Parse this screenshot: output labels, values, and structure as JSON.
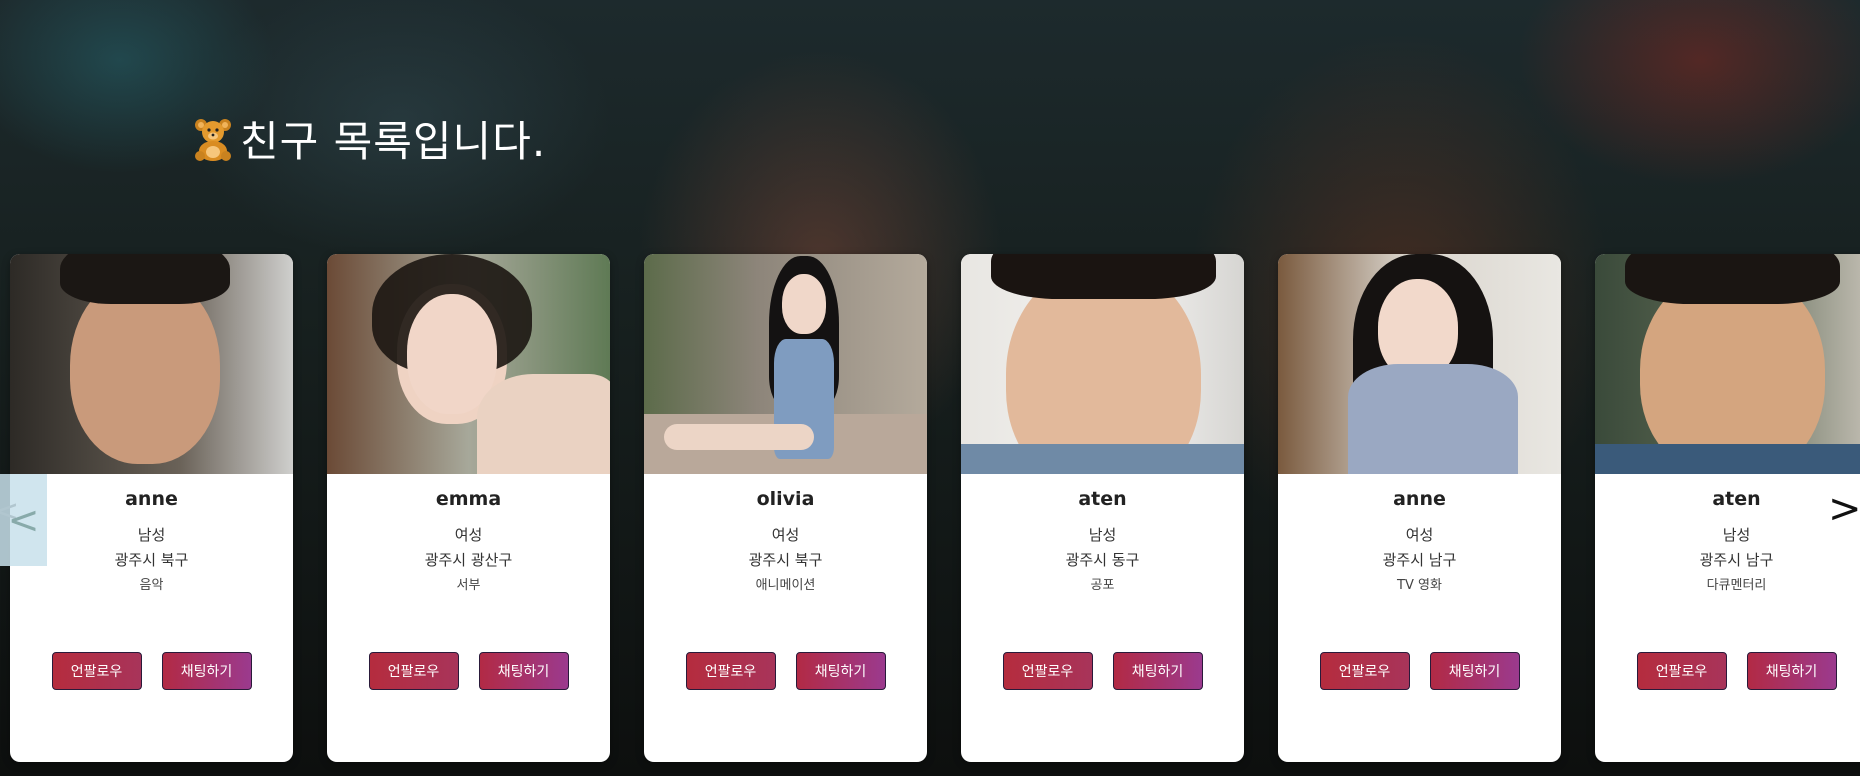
{
  "page": {
    "title": "친구 목록입니다.",
    "title_icon": "teddy-bear-icon"
  },
  "carousel": {
    "prev_label": "<",
    "next_label": ">",
    "cards": [
      {
        "name": "anne",
        "gender": "남성",
        "region": "광주시 북구",
        "genre": "음악",
        "follow_label": "언팔로우",
        "chat_label": "채팅하기"
      },
      {
        "name": "emma",
        "gender": "여성",
        "region": "광주시 광산구",
        "genre": "서부",
        "follow_label": "언팔로우",
        "chat_label": "채팅하기"
      },
      {
        "name": "olivia",
        "gender": "여성",
        "region": "광주시 북구",
        "genre": "애니메이션",
        "follow_label": "언팔로우",
        "chat_label": "채팅하기"
      },
      {
        "name": "aten",
        "gender": "남성",
        "region": "광주시 동구",
        "genre": "공포",
        "follow_label": "언팔로우",
        "chat_label": "채팅하기"
      },
      {
        "name": "anne",
        "gender": "여성",
        "region": "광주시 남구",
        "genre": "TV 영화",
        "follow_label": "언팔로우",
        "chat_label": "채팅하기"
      },
      {
        "name": "aten",
        "gender": "남성",
        "region": "광주시 남구",
        "genre": "다큐멘터리",
        "follow_label": "언팔로우",
        "chat_label": "채팅하기"
      }
    ]
  },
  "colors": {
    "button_gradient_start": "#b22a45",
    "button_gradient_end": "#9b3a8e",
    "card_bg": "#ffffff",
    "title_color": "#ffffff"
  }
}
